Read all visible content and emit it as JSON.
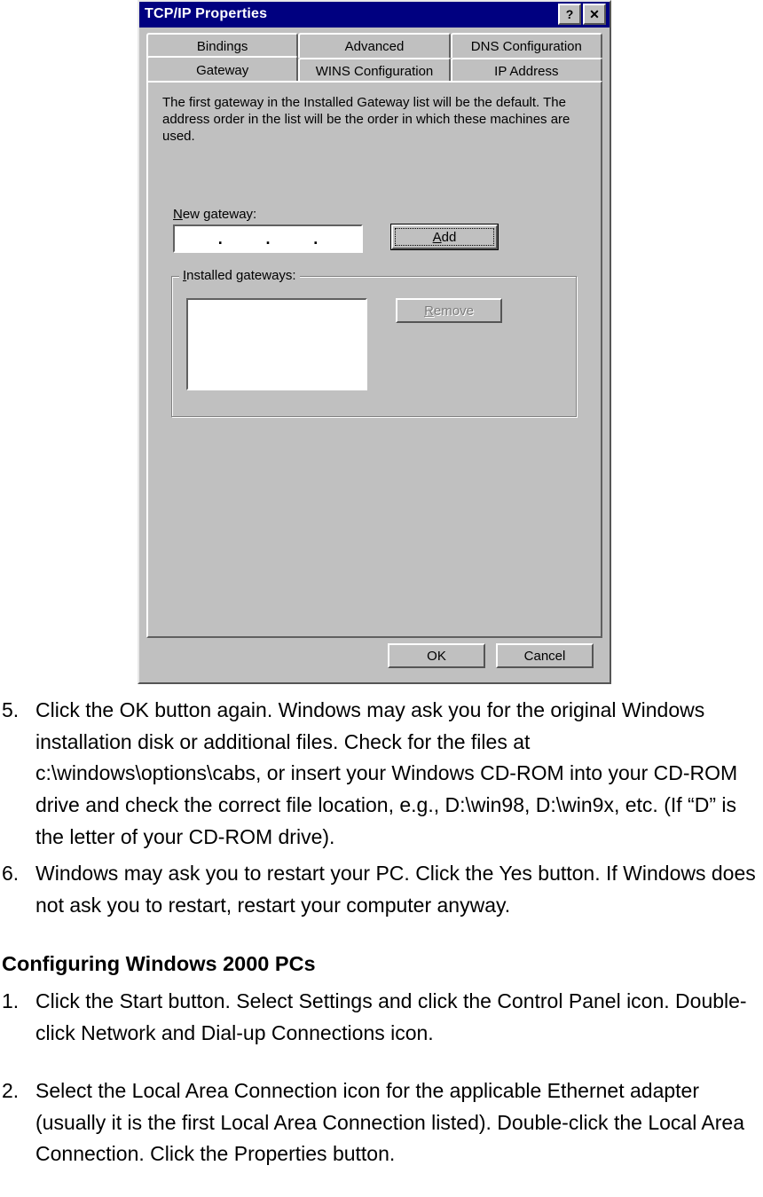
{
  "dialog": {
    "title": "TCP/IP Properties",
    "help_btn": "?",
    "close_btn": "✕",
    "tabs_back": [
      "Bindings",
      "Advanced",
      "DNS Configuration"
    ],
    "tabs_front": [
      "Gateway",
      "WINS Configuration",
      "IP Address"
    ],
    "description": "The first gateway in the Installed Gateway list will be the default. The address order in the list will be the order in which these machines are used.",
    "new_gateway_prefix": "N",
    "new_gateway_rest": "ew gateway:",
    "add_prefix": "A",
    "add_rest": "dd",
    "installed_prefix": "I",
    "installed_rest": "nstalled gateways:",
    "remove_prefix": "R",
    "remove_rest": "emove",
    "ok": "OK",
    "cancel": "Cancel"
  },
  "doc": {
    "item5_num": "5.",
    "item5_text": "Click the OK button again. Windows may ask you for the original Windows installation disk or additional files. Check for the files at c:\\windows\\options\\cabs, or insert your Windows CD-ROM into your CD-ROM drive and check the correct file location, e.g., D:\\win98, D:\\win9x, etc. (If “D” is the letter of your CD-ROM drive).",
    "item6_num": "6.",
    "item6_text": "Windows may ask you to restart your PC. Click the Yes button. If Windows does not ask you to restart, restart your computer anyway.",
    "heading": "Configuring Windows 2000 PCs",
    "item1_num": "1.",
    "item1_text": "Click the Start button. Select Settings and click the Control Panel icon. Double-click Network and Dial-up Connections icon.",
    "item2_num": "2.",
    "item2_text": "Select the Local Area Connection icon for the applicable Ethernet adapter (usually it is the first Local Area Connection listed). Double-click the Local Area Connection. Click the Properties button."
  }
}
